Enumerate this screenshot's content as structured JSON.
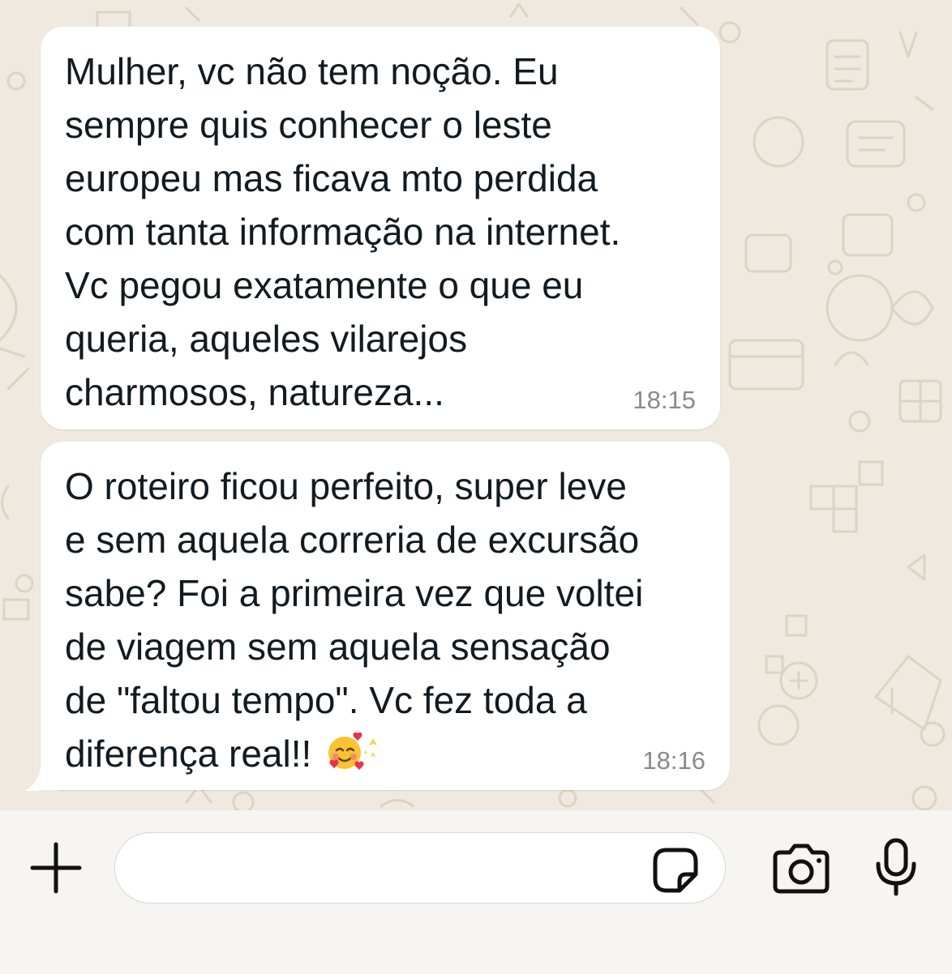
{
  "messages": [
    {
      "text": "Mulher, vc não tem noção. Eu\nsempre quis conhecer o leste\neuropeu mas ficava mto perdida\ncom tanta informação na internet.\nVc pegou exatamente o que eu\nqueria, aqueles vilarejos\ncharmosos, natureza...",
      "time": "18:15"
    },
    {
      "text": "O roteiro ficou perfeito, super leve\ne sem aquela correria de excursão\nsabe? Foi a primeira vez que voltei\nde viagem sem aquela sensação\nde \"faltou tempo\". Vc fez toda a\ndiferença real!! ",
      "emojis": [
        "smiling-face-with-hearts-emoji",
        "sparkles-emoji"
      ],
      "time": "18:16"
    }
  ],
  "composer": {
    "input_value": "",
    "icons": [
      "plus-icon",
      "sticker-icon",
      "camera-icon",
      "microphone-icon"
    ]
  },
  "colors": {
    "chat_background": "#efe9df",
    "bubble": "#ffffff",
    "text": "#111b21",
    "timestamp": "#8a8a8a"
  }
}
